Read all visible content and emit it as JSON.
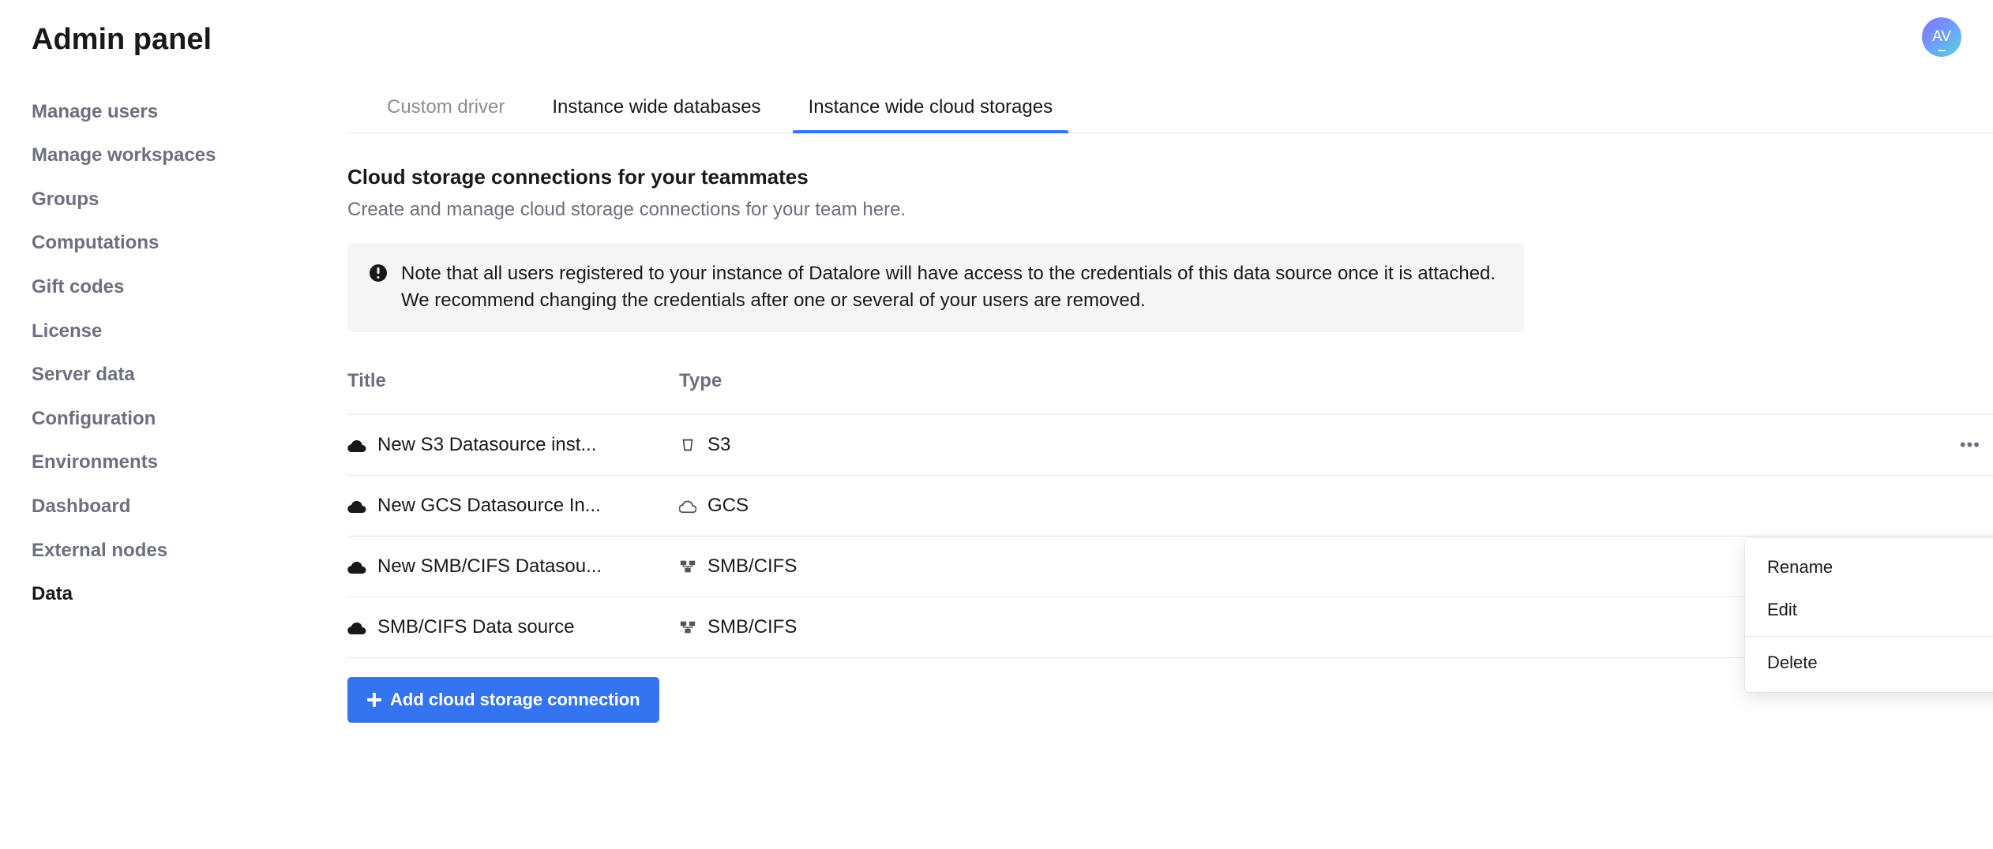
{
  "header": {
    "title": "Admin panel",
    "avatar_initials": "AV"
  },
  "sidebar": {
    "items": [
      {
        "label": "Manage users",
        "active": false
      },
      {
        "label": "Manage workspaces",
        "active": false
      },
      {
        "label": "Groups",
        "active": false
      },
      {
        "label": "Computations",
        "active": false
      },
      {
        "label": "Gift codes",
        "active": false
      },
      {
        "label": "License",
        "active": false
      },
      {
        "label": "Server data",
        "active": false
      },
      {
        "label": "Configuration",
        "active": false
      },
      {
        "label": "Environments",
        "active": false
      },
      {
        "label": "Dashboard",
        "active": false
      },
      {
        "label": "External nodes",
        "active": false
      },
      {
        "label": "Data",
        "active": true
      }
    ]
  },
  "tabs": [
    {
      "label": "Custom driver",
      "state": "inactive"
    },
    {
      "label": "Instance wide databases",
      "state": "normal"
    },
    {
      "label": "Instance wide cloud storages",
      "state": "active"
    }
  ],
  "section": {
    "title": "Cloud storage connections for your teammates",
    "description": "Create and manage cloud storage connections for your team here."
  },
  "notice": {
    "text": "Note that all users registered to your instance of Datalore will have access to the credentials of this data source once it is attached. We recommend changing the credentials after one or several of your users are removed."
  },
  "table": {
    "columns": [
      "Title",
      "Type"
    ],
    "rows": [
      {
        "title": "New S3 Datasource inst...",
        "type": "S3",
        "type_icon": "bucket",
        "show_more": true
      },
      {
        "title": "New GCS Datasource In...",
        "type": "GCS",
        "type_icon": "gcs",
        "show_more": false
      },
      {
        "title": "New SMB/CIFS Datasou...",
        "type": "SMB/CIFS",
        "type_icon": "smb",
        "show_more": false
      },
      {
        "title": "SMB/CIFS Data source",
        "type": "SMB/CIFS",
        "type_icon": "smb",
        "show_more": true
      }
    ]
  },
  "add_button": {
    "label": "Add cloud storage connection"
  },
  "context_menu": {
    "items": [
      "Rename",
      "Edit",
      "Delete"
    ]
  }
}
